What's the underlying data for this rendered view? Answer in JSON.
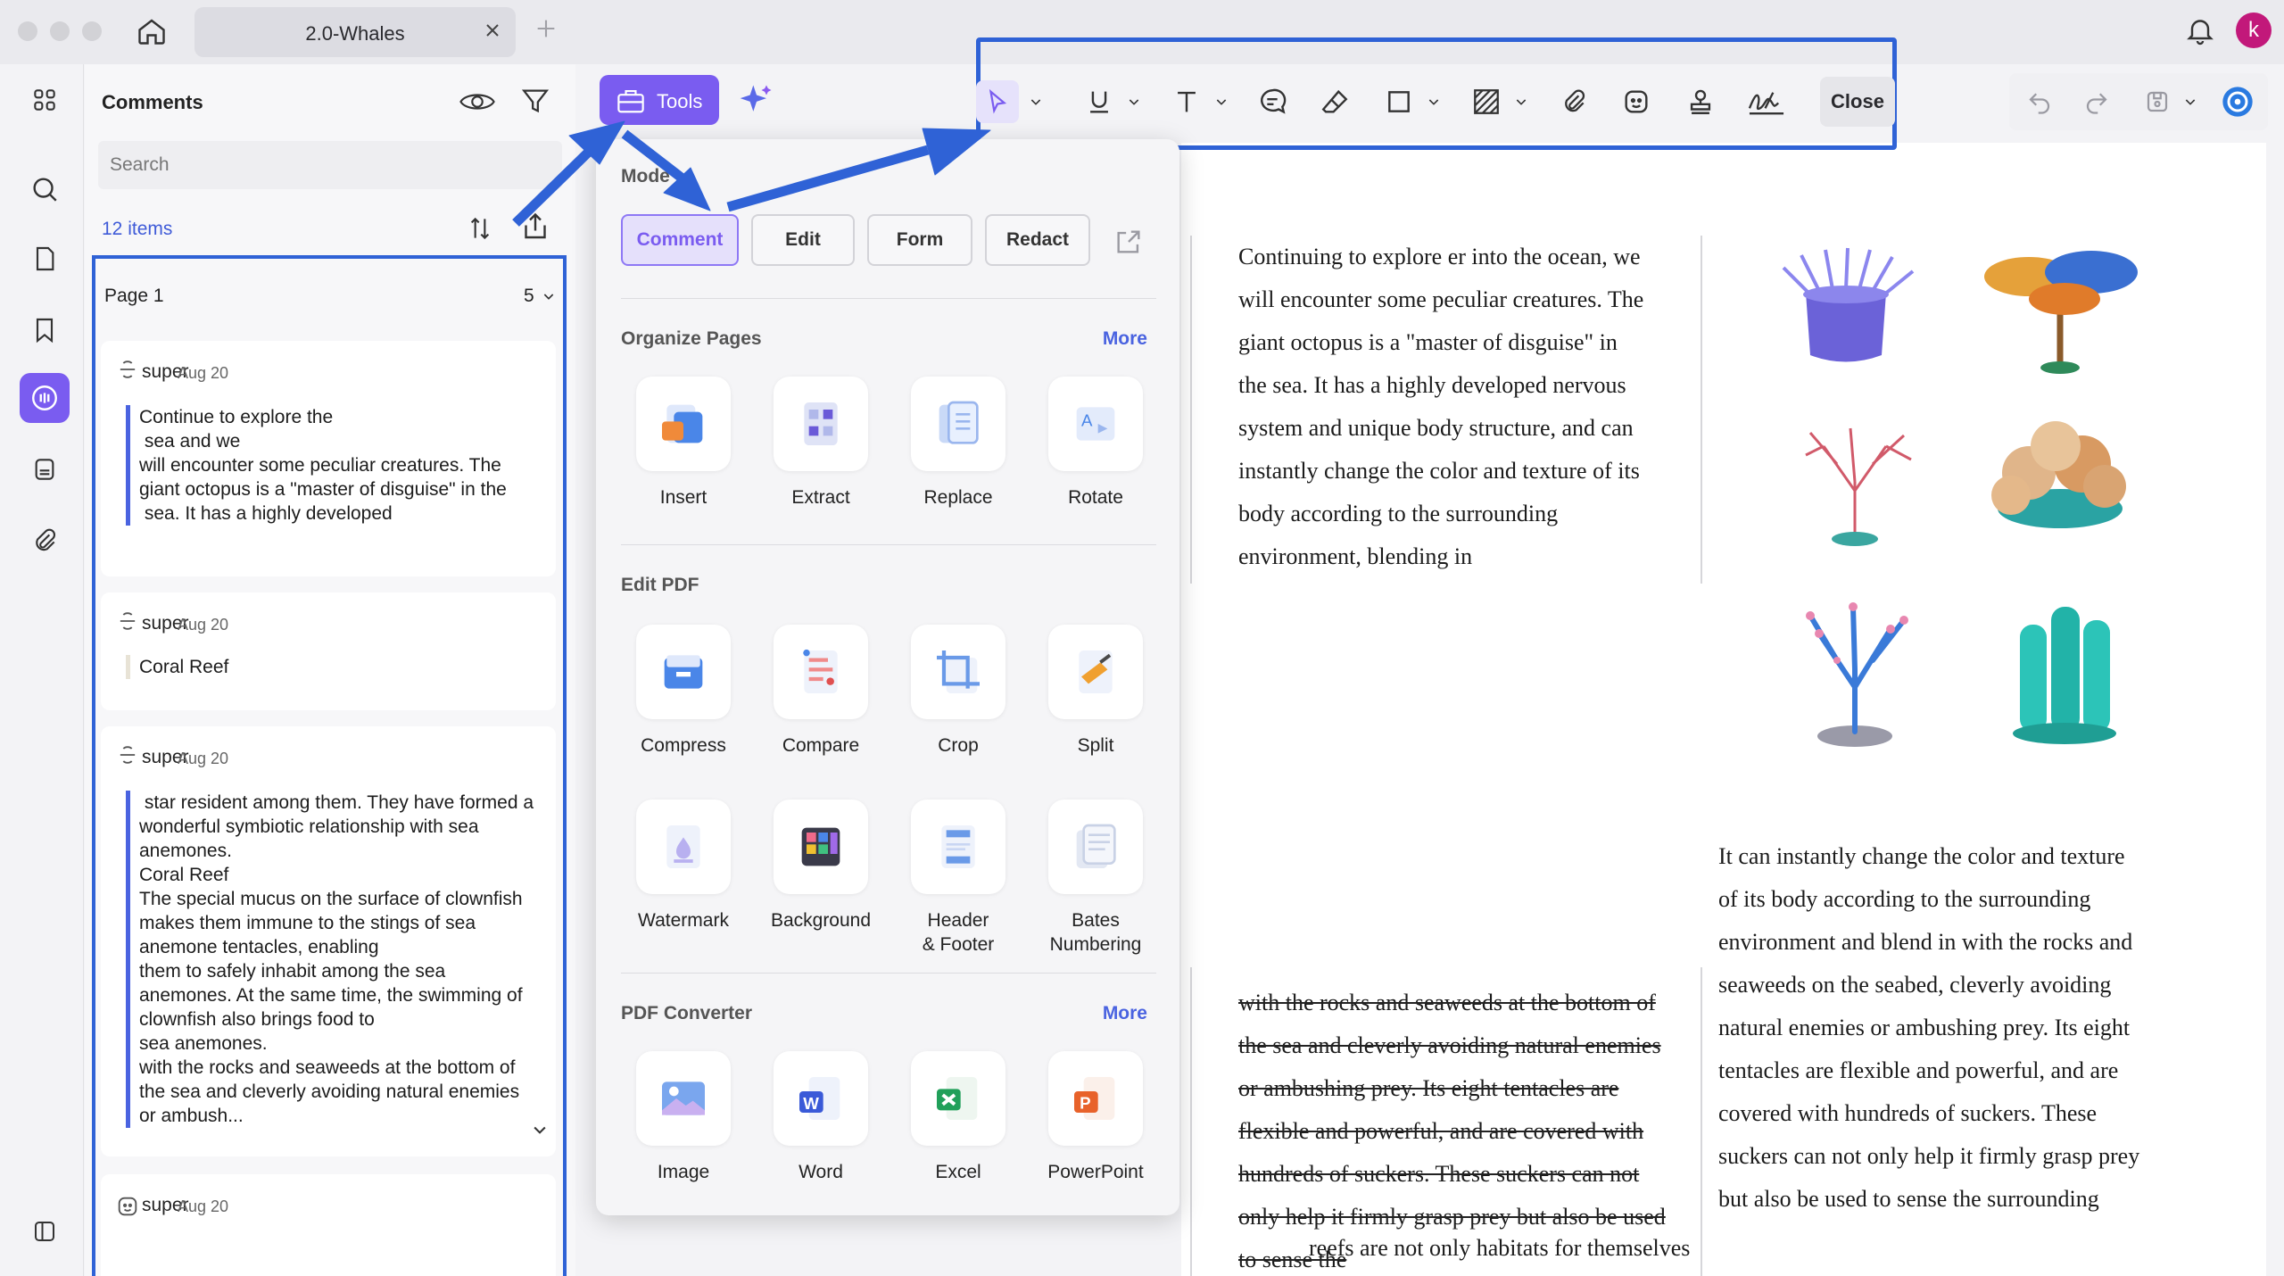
{
  "window": {
    "tab_title": "2.0-Whales",
    "avatar_letter": "k"
  },
  "comments_panel": {
    "title": "Comments",
    "search_placeholder": "Search",
    "count": "12 items",
    "page_group": {
      "label": "Page 1",
      "count": "5"
    },
    "comments": [
      {
        "user": "super",
        "date": "Aug 20",
        "text": "Continue to explore the\n sea and we\nwill encounter some peculiar creatures. The giant octopus is a \"master of disguise\" in the\n sea. It has a highly developed"
      },
      {
        "user": "super",
        "date": "Aug 20",
        "text": "Coral Reef"
      },
      {
        "user": "super",
        "date": "Aug 20",
        "text": " star resident among them. They have formed a wonderful symbiotic relationship with sea anemones.\nCoral Reef\nThe special mucus on the surface of clownfish makes them immune to the stings of sea anemone tentacles, enabling\nthem to safely inhabit among the sea anemones. At the same time, the swimming of clownfish also brings food to\nsea anemones.\nwith the rocks and seaweeds at the bottom of the sea and cleverly avoiding natural enemies or ambush..."
      },
      {
        "user": "super",
        "date": "Aug 20",
        "text": ""
      }
    ]
  },
  "toolbar": {
    "tools_label": "Tools",
    "close_label": "Close"
  },
  "tools_menu": {
    "mode_label": "Mode",
    "modes": [
      "Comment",
      "Edit",
      "Form",
      "Redact"
    ],
    "sections": [
      {
        "title": "Organize Pages",
        "more": "More",
        "items": [
          "Insert",
          "Extract",
          "Replace",
          "Rotate"
        ]
      },
      {
        "title": "Edit PDF",
        "more": "",
        "items": [
          "Compress",
          "Compare",
          "Crop",
          "Split",
          "Watermark",
          "Background",
          "Header\n& Footer",
          "Bates\nNumbering"
        ]
      },
      {
        "title": "PDF Converter",
        "more": "More",
        "items": [
          "Image",
          "Word",
          "Excel",
          "PowerPoint"
        ]
      }
    ]
  },
  "document": {
    "left_col": "Continuing to explore        er into the ocean, we will encounter some peculiar creatures. The giant octopus is a \"master of disguise\" in the        sea. It has a highly developed nervous system and unique body structure, and can instantly change the color and texture of its body according to the surrounding environment, blending in",
    "right_col": "It can instantly change the color and texture of its body according to the surrounding environment and blend in with the rocks and seaweeds on the seabed, cleverly avoiding natural enemies or ambushing prey. Its eight tentacles are flexible and powerful, and are covered with hundreds of suckers. These suckers can not only help it firmly grasp prey but also be used to sense the surrounding",
    "struck_text": "with the rocks and seaweeds at the bottom of the sea and cleverly avoiding natural enemies or ambushing prey. Its eight tentacles are flexible and powerful, and are covered with hundreds of suckers. These suckers can not only help it firmly grasp prey but also be used to sense the",
    "bottom_line": "reefs are not only habitats for themselves"
  },
  "colors": {
    "accent": "#7a5cf0",
    "highlight_frame": "#2f62d6",
    "link": "#4a63e0"
  }
}
